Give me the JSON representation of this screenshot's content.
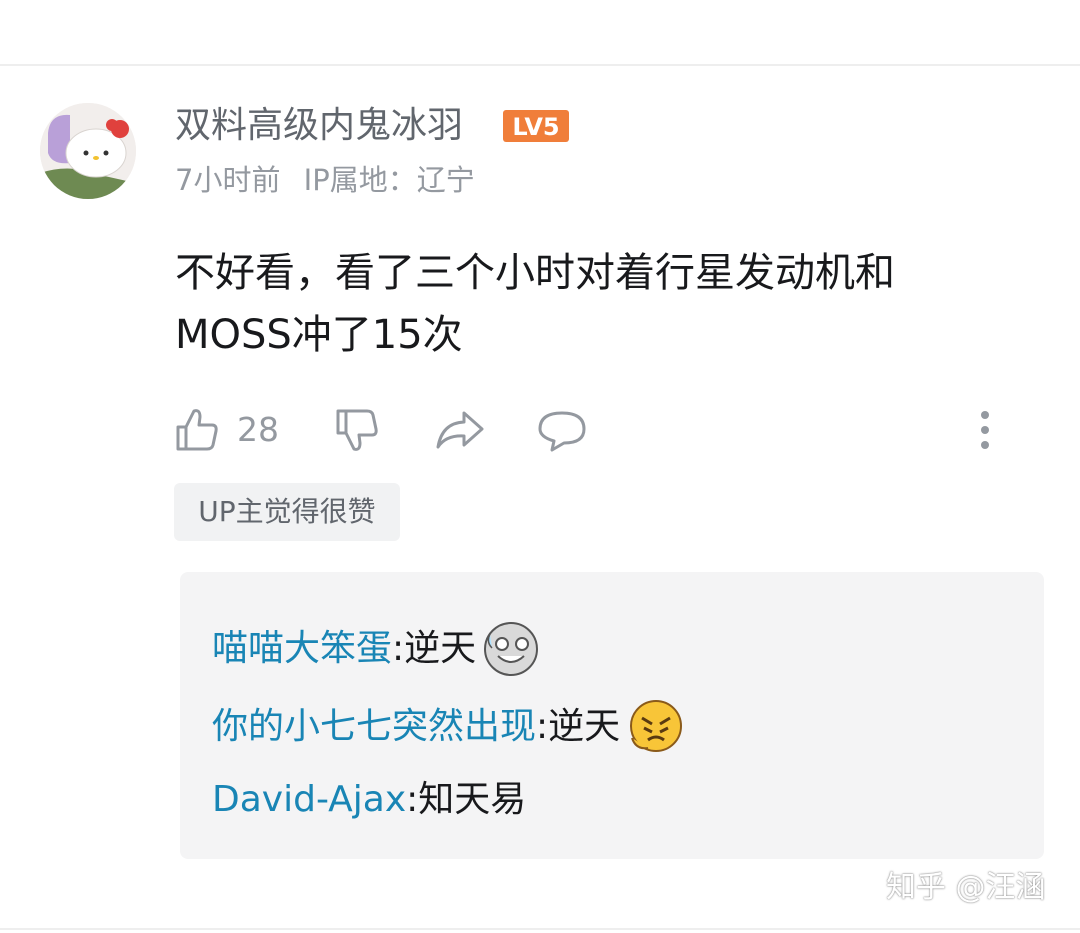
{
  "comment": {
    "username": "双料高级内鬼冰羽",
    "level_badge": "LV5",
    "time": "7小时前",
    "ip_location": "IP属地：辽宁",
    "content": "不好看，看了三个小时对着行星发动机和\nMOSS冲了15次",
    "like_count": "28",
    "up_tag": "UP主觉得很赞"
  },
  "replies": [
    {
      "name": "喵喵大笨蛋",
      "colon": ":",
      "text": " 逆天",
      "emoji": "laughing-emoji"
    },
    {
      "name": "你的小七七突然出现",
      "colon": ":",
      "text": " 逆天",
      "emoji": "frustrated-emoji"
    },
    {
      "name": "David-Ajax",
      "colon": ":",
      "text": " 知天易",
      "emoji": ""
    }
  ],
  "watermark": "知乎 @汪涵",
  "colors": {
    "username": "#61666d",
    "reply_name": "#1985b5",
    "badge": "#f07e3a",
    "tag_bg": "#f1f2f3"
  }
}
